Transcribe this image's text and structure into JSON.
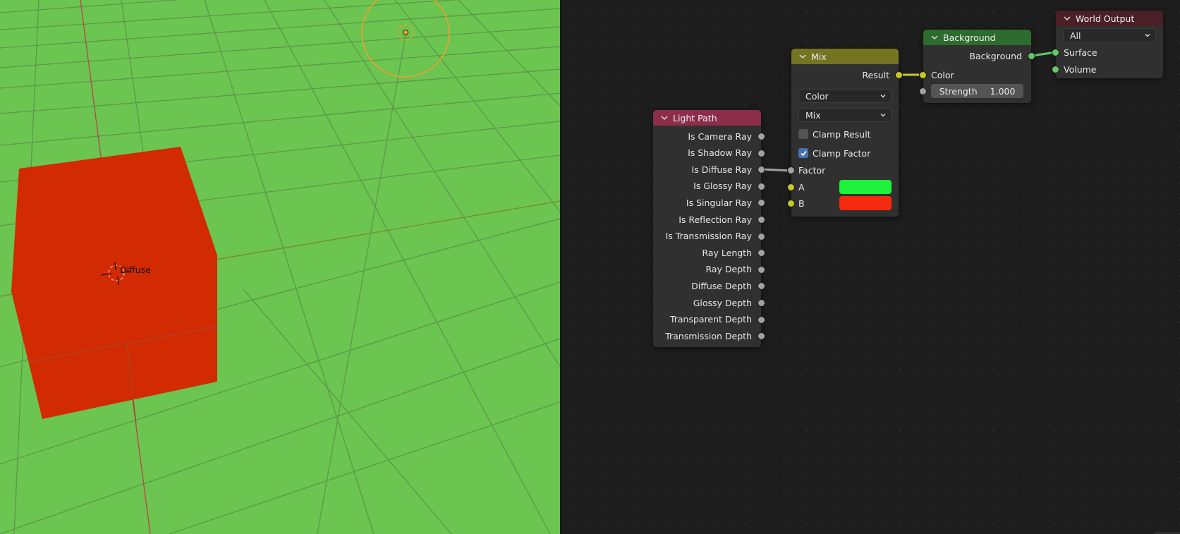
{
  "viewport": {
    "background_color": "#6cc451",
    "object_color": "#d22a03",
    "object_label": "Diffuse",
    "light_color": "#f0a030"
  },
  "node_editor": {
    "background_color": "#1d1d1d",
    "nodes": {
      "light_path": {
        "title": "Light Path",
        "header_color": "#8c2e4a",
        "outputs": [
          "Is Camera Ray",
          "Is Shadow Ray",
          "Is Diffuse Ray",
          "Is Glossy Ray",
          "Is Singular Ray",
          "Is Reflection Ray",
          "Is Transmission Ray",
          "Ray Length",
          "Ray Depth",
          "Diffuse Depth",
          "Glossy Depth",
          "Transparent Depth",
          "Transmission Depth"
        ]
      },
      "mix": {
        "title": "Mix",
        "header_color": "#747421",
        "output": "Result",
        "data_type": "Color",
        "blend_mode": "Mix",
        "clamp_result": {
          "label": "Clamp Result",
          "checked": false
        },
        "clamp_factor": {
          "label": "Clamp Factor",
          "checked": true
        },
        "inputs": {
          "factor": "Factor",
          "a": "A",
          "b": "B"
        },
        "color_a": "#1ef23c",
        "color_b": "#f52a0f"
      },
      "background": {
        "title": "Background",
        "header_color": "#2e6b2e",
        "output": "Background",
        "input_color": "Color",
        "strength_label": "Strength",
        "strength_value": "1.000"
      },
      "world_output": {
        "title": "World Output",
        "header_color": "#4a1f27",
        "target": "All",
        "inputs": [
          "Surface",
          "Volume"
        ]
      }
    },
    "links": [
      {
        "from": "Light Path.Is Diffuse Ray",
        "to": "Mix.Factor"
      },
      {
        "from": "Mix.Result",
        "to": "Background.Color"
      },
      {
        "from": "Background.Background",
        "to": "World Output.Surface"
      }
    ]
  }
}
